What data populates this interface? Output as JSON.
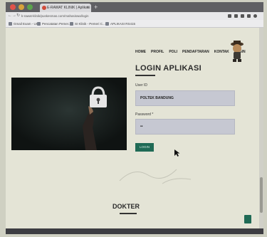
{
  "browser": {
    "tab_title": "E-RAWAT KLINIK | Aplikasi",
    "tab_close": "×",
    "new_tab": "+",
    "url": "k-rawat-klinik/puskesmas.com/mahasiswa/login",
    "nav_back": "←",
    "nav_forward": "→",
    "nav_reload": "↻",
    "bookmarks": [
      "Gmail Exam - Uni",
      "Pencatatan Pemer...",
      "SI Klinik - Pemeri C...",
      "APLIKASI RS415"
    ]
  },
  "nav": {
    "items": [
      "HOME",
      "PROFIL",
      "POLI",
      "PENDAFTARAN",
      "KONTAK",
      "LOGIN"
    ]
  },
  "login": {
    "title": "LOGIN APLIKASI",
    "user_label": "User ID",
    "user_value": "POLTEK BANDUNG",
    "password_label": "Password *",
    "password_value": "••",
    "button_label": "LOGIN"
  },
  "section": {
    "title": "DOKTER"
  },
  "colors": {
    "accent": "#1f6a55",
    "field_bg": "#c6c8d2",
    "page_bg": "#e4e4d6"
  }
}
